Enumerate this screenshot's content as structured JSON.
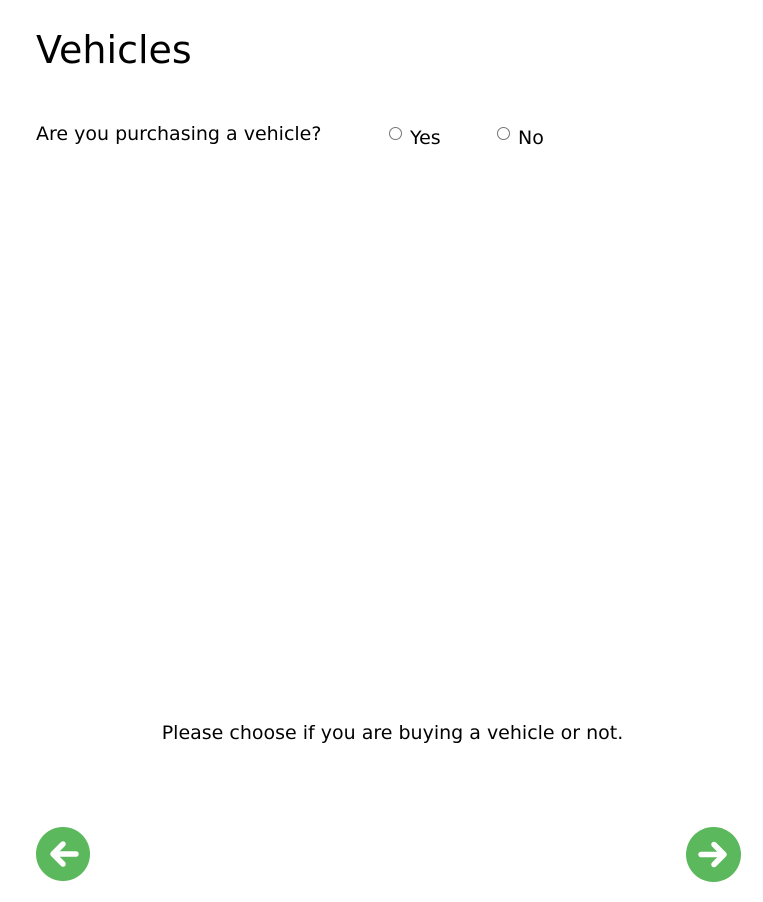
{
  "page": {
    "title": "Vehicles"
  },
  "question": {
    "label": "Are you purchasing a vehicle?",
    "options": [
      {
        "label": "Yes",
        "selected": false
      },
      {
        "label": "No",
        "selected": false
      }
    ]
  },
  "hint": {
    "text": "Please choose if you are buying a vehicle or not."
  },
  "navigation": {
    "back_icon": "arrow-left-icon",
    "next_icon": "arrow-right-icon",
    "button_color": "#5cb85c",
    "icon_color": "#ffffff"
  }
}
